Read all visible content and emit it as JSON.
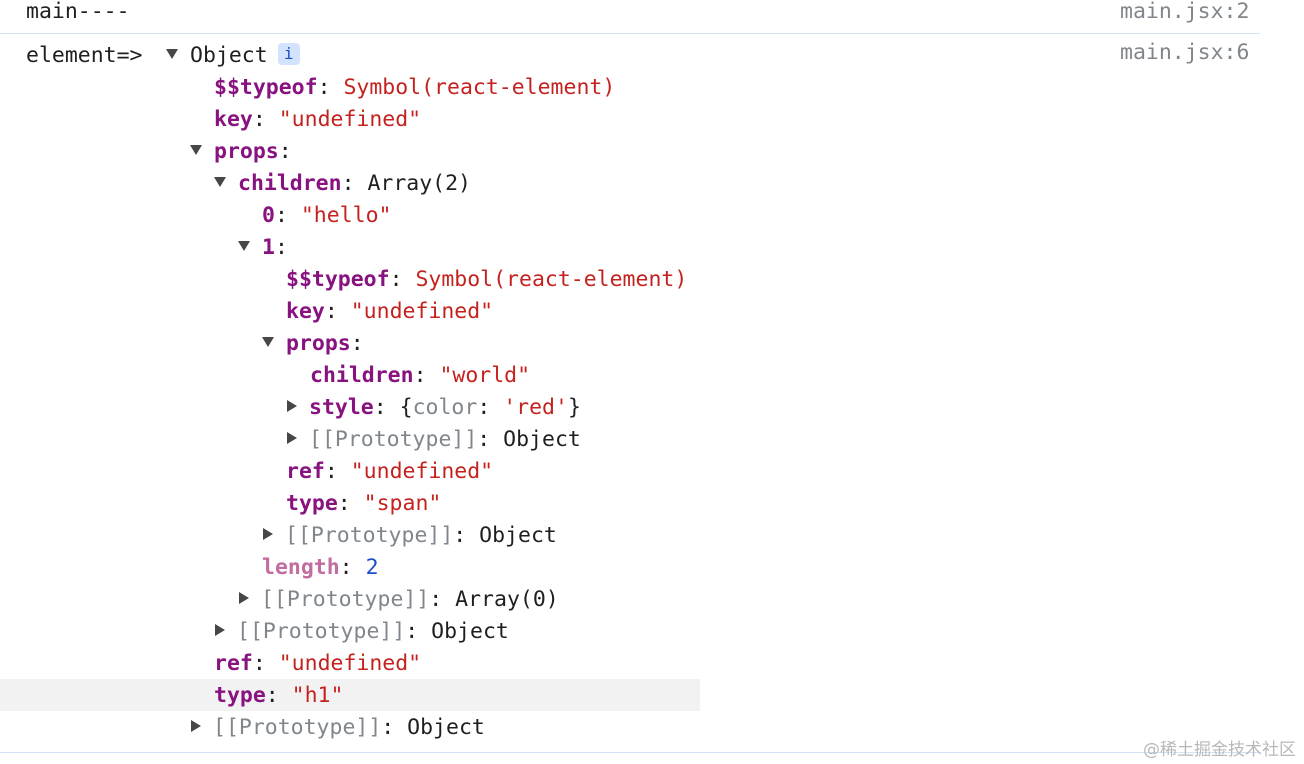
{
  "messages": [
    {
      "text": "main----",
      "source": "main.jsx:2"
    },
    {
      "prefix": "element=>",
      "source": "main.jsx:6"
    }
  ],
  "tree": [
    {
      "type": "expand",
      "label": "Object",
      "info_icon": "i"
    },
    {
      "key": "$$typeof",
      "sep": ": ",
      "value": "Symbol(react-element)",
      "vclass": "str"
    },
    {
      "key": "key",
      "sep": ": ",
      "value": "\"undefined\"",
      "vclass": "str"
    },
    {
      "key": "props",
      "sep": ":",
      "value": "",
      "expanded": true
    },
    {
      "key": "children",
      "sep": ": ",
      "value": "Array(2)",
      "vclass": "plain",
      "expanded": true
    },
    {
      "key": "0",
      "sep": ": ",
      "value": "\"hello\"",
      "vclass": "str"
    },
    {
      "key": "1",
      "sep": ":",
      "value": "",
      "expanded": true
    },
    {
      "key": "$$typeof",
      "sep": ": ",
      "value": "Symbol(react-element)",
      "vclass": "str"
    },
    {
      "key": "key",
      "sep": ": ",
      "value": "\"undefined\"",
      "vclass": "str"
    },
    {
      "key": "props",
      "sep": ":",
      "value": "",
      "expanded": true
    },
    {
      "key": "children",
      "sep": ": ",
      "value": "\"world\"",
      "vclass": "str"
    },
    {
      "key": "style",
      "sep": ": ",
      "value": "{color: 'red'}",
      "vclass": "style",
      "collapsed": true,
      "style_preview": {
        "open": "{",
        "prop": "color",
        "colon": ": ",
        "val": "'red'",
        "close": "}"
      }
    },
    {
      "key": "[[Prototype]]",
      "sep": ": ",
      "value": "Object",
      "vclass": "plain",
      "collapsed": true,
      "proto": true
    },
    {
      "key": "ref",
      "sep": ": ",
      "value": "\"undefined\"",
      "vclass": "str"
    },
    {
      "key": "type",
      "sep": ": ",
      "value": "\"span\"",
      "vclass": "str"
    },
    {
      "key": "[[Prototype]]",
      "sep": ": ",
      "value": "Object",
      "vclass": "plain",
      "collapsed": true,
      "proto": true
    },
    {
      "key": "length",
      "sep": ": ",
      "value": "2",
      "vclass": "num",
      "dim": true
    },
    {
      "key": "[[Prototype]]",
      "sep": ": ",
      "value": "Array(0)",
      "vclass": "plain",
      "collapsed": true,
      "proto": true
    },
    {
      "key": "[[Prototype]]",
      "sep": ": ",
      "value": "Object",
      "vclass": "plain",
      "collapsed": true,
      "proto": true
    },
    {
      "key": "ref",
      "sep": ": ",
      "value": "\"undefined\"",
      "vclass": "str"
    },
    {
      "key": "type",
      "sep": ": ",
      "value": "\"h1\"",
      "vclass": "str",
      "highlighted": true
    },
    {
      "key": "[[Prototype]]",
      "sep": ": ",
      "value": "Object",
      "vclass": "plain",
      "collapsed": true,
      "proto": true
    }
  ],
  "watermark": "@稀土掘金技术社区",
  "colors": {
    "key": "#881280",
    "string": "#c5221f",
    "number": "#1a4ec8",
    "proto": "#80868b",
    "divider": "#d1e3f8",
    "highlight": "#f2f2f2"
  }
}
